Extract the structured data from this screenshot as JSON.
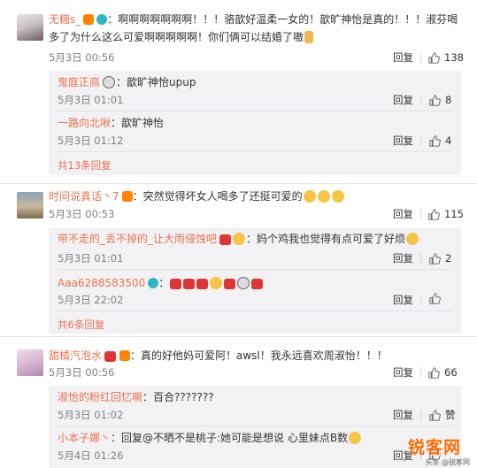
{
  "comments": [
    {
      "username": "无糖s_",
      "text_line1": "：啊啊啊啊啊啊啊！！！骆歆好温柔一女的！歆旷神怡是真的！！！淑芬喝",
      "text_line2": "多了为什么这么可爱啊啊啊啊啊！你们俩可以结婚了嗷",
      "time": "5月3日 00:56",
      "reply_label": "回复",
      "likes": "138",
      "replies": [
        {
          "username": "鬼庭正高",
          "text": "：歆旷神怡upup",
          "time": "5月3日 01:01",
          "reply_label": "回复",
          "likes": "8"
        },
        {
          "username": "一路向北啾",
          "text": "：歆旷神怡",
          "time": "5月3日 01:12",
          "reply_label": "回复",
          "likes": "4"
        }
      ],
      "more_replies": "共13条回复"
    },
    {
      "username": "时间说真话丶7",
      "text_line1": "：突然觉得坏女人喝多了还挺可爱的",
      "time": "5月3日 00:53",
      "reply_label": "回复",
      "likes": "115",
      "replies": [
        {
          "username": "带不走的_丢不掉的_让大雨侵蚀吧",
          "text": "：妈个鸡我也觉得有点可爱了好烦",
          "time": "5月3日 01:01",
          "reply_label": "回复",
          "likes": "2"
        },
        {
          "username": "Aaa6288583500",
          "text": "：",
          "time": "5月3日 22:02",
          "reply_label": "回复",
          "likes": ""
        }
      ],
      "more_replies": "共6条回复"
    },
    {
      "username": "甜橘汽泡水",
      "text_line1": "：真的好他妈可爱阿！awsl！我永远喜欢周淑怡！！！",
      "time": "5月3日 00:56",
      "reply_label": "回复",
      "likes": "66",
      "replies": [
        {
          "username": "淑怡的粉红回忆噘",
          "text": "：百合???????",
          "time": "5月3日 01:02",
          "reply_label": "回复",
          "likes": "赞"
        },
        {
          "username": "小本子娜丶",
          "text": "：回复@不晒不是桃子:她可能是想说 心里妹点B数",
          "time": "5月4日 01:26",
          "reply_label": "回复",
          "likes": ""
        }
      ]
    }
  ],
  "watermark": {
    "logo": "锐客网",
    "sub": "头条 @锐客网"
  },
  "colors": {
    "username": "#eb7350",
    "reply_bg": "#f2f2f5",
    "meta": "#808080"
  }
}
